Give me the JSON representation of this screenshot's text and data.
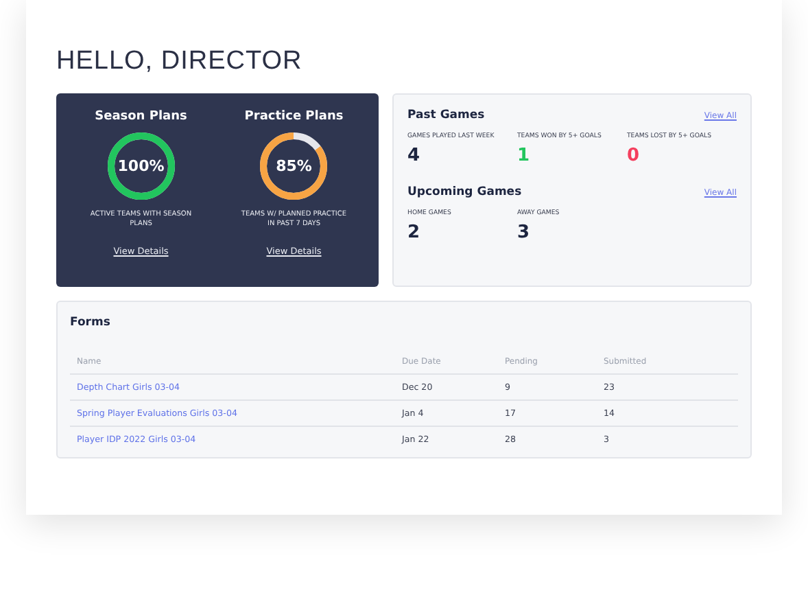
{
  "greeting": "HELLO, DIRECTOR",
  "plans": [
    {
      "title": "Season Plans",
      "percent": "100%",
      "color": "#22c55e",
      "caption": "ACTIVE TEAMS WITH SEASON PLANS",
      "link": "View Details"
    },
    {
      "title": "Practice Plans",
      "percent": "85%",
      "color": "#f7a444",
      "caption": "TEAMS W/ PLANNED PRACTICE IN PAST 7 DAYS",
      "link": "View Details"
    }
  ],
  "games": [
    {
      "title": "Past Games",
      "link": "View All",
      "stats": [
        {
          "label": "GAMES PLAYED LAST WEEK",
          "value": "4",
          "color": "#1d2540"
        },
        {
          "label": "TEAMS WON BY 5+ GOALS",
          "value": "1",
          "color": "#22c55e"
        },
        {
          "label": "TEAMS LOST BY 5+ GOALS",
          "value": "0",
          "color": "#f43f5e"
        }
      ]
    },
    {
      "title": "Upcoming Games",
      "link": "View All",
      "stats": [
        {
          "label": "HOME GAMES",
          "value": "2",
          "color": "#1d2540"
        },
        {
          "label": "AWAY GAMES",
          "value": "3",
          "color": "#1d2540"
        }
      ]
    }
  ],
  "forms": {
    "title": "Forms",
    "columns": [
      "Name",
      "Due Date",
      "Pending",
      "Submitted"
    ],
    "rows": [
      [
        "Depth Chart Girls 03-04",
        "Dec 20",
        "9",
        "23"
      ],
      [
        "Spring Player Evaluations Girls 03-04",
        "Jan 4",
        "17",
        "14"
      ],
      [
        "Player IDP 2022 Girls 03-04",
        "Jan 22",
        "28",
        "3"
      ]
    ]
  }
}
